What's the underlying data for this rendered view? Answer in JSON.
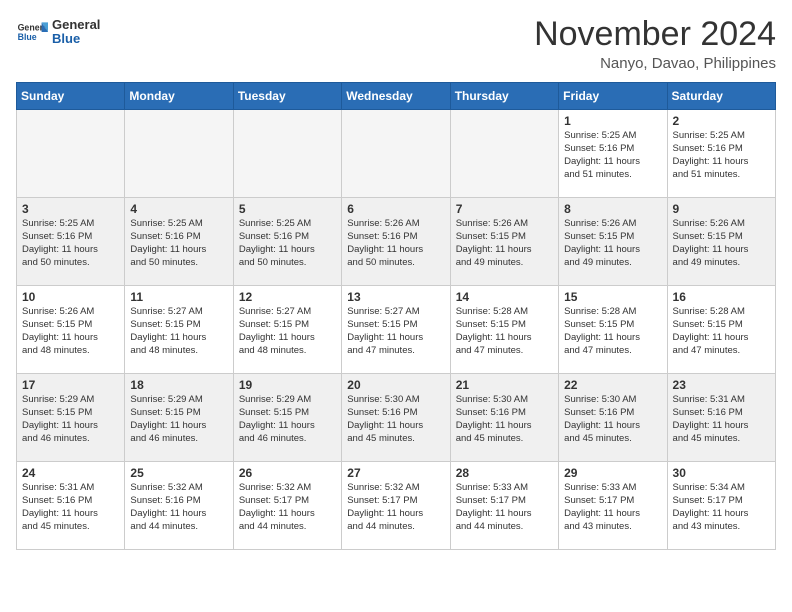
{
  "logo": {
    "general": "General",
    "blue": "Blue"
  },
  "title": "November 2024",
  "location": "Nanyo, Davao, Philippines",
  "header": {
    "days": [
      "Sunday",
      "Monday",
      "Tuesday",
      "Wednesday",
      "Thursday",
      "Friday",
      "Saturday"
    ]
  },
  "weeks": [
    [
      {
        "day": "",
        "content": ""
      },
      {
        "day": "",
        "content": ""
      },
      {
        "day": "",
        "content": ""
      },
      {
        "day": "",
        "content": ""
      },
      {
        "day": "",
        "content": ""
      },
      {
        "day": "1",
        "content": "Sunrise: 5:25 AM\nSunset: 5:16 PM\nDaylight: 11 hours\nand 51 minutes."
      },
      {
        "day": "2",
        "content": "Sunrise: 5:25 AM\nSunset: 5:16 PM\nDaylight: 11 hours\nand 51 minutes."
      }
    ],
    [
      {
        "day": "3",
        "content": "Sunrise: 5:25 AM\nSunset: 5:16 PM\nDaylight: 11 hours\nand 50 minutes."
      },
      {
        "day": "4",
        "content": "Sunrise: 5:25 AM\nSunset: 5:16 PM\nDaylight: 11 hours\nand 50 minutes."
      },
      {
        "day": "5",
        "content": "Sunrise: 5:25 AM\nSunset: 5:16 PM\nDaylight: 11 hours\nand 50 minutes."
      },
      {
        "day": "6",
        "content": "Sunrise: 5:26 AM\nSunset: 5:16 PM\nDaylight: 11 hours\nand 50 minutes."
      },
      {
        "day": "7",
        "content": "Sunrise: 5:26 AM\nSunset: 5:15 PM\nDaylight: 11 hours\nand 49 minutes."
      },
      {
        "day": "8",
        "content": "Sunrise: 5:26 AM\nSunset: 5:15 PM\nDaylight: 11 hours\nand 49 minutes."
      },
      {
        "day": "9",
        "content": "Sunrise: 5:26 AM\nSunset: 5:15 PM\nDaylight: 11 hours\nand 49 minutes."
      }
    ],
    [
      {
        "day": "10",
        "content": "Sunrise: 5:26 AM\nSunset: 5:15 PM\nDaylight: 11 hours\nand 48 minutes."
      },
      {
        "day": "11",
        "content": "Sunrise: 5:27 AM\nSunset: 5:15 PM\nDaylight: 11 hours\nand 48 minutes."
      },
      {
        "day": "12",
        "content": "Sunrise: 5:27 AM\nSunset: 5:15 PM\nDaylight: 11 hours\nand 48 minutes."
      },
      {
        "day": "13",
        "content": "Sunrise: 5:27 AM\nSunset: 5:15 PM\nDaylight: 11 hours\nand 47 minutes."
      },
      {
        "day": "14",
        "content": "Sunrise: 5:28 AM\nSunset: 5:15 PM\nDaylight: 11 hours\nand 47 minutes."
      },
      {
        "day": "15",
        "content": "Sunrise: 5:28 AM\nSunset: 5:15 PM\nDaylight: 11 hours\nand 47 minutes."
      },
      {
        "day": "16",
        "content": "Sunrise: 5:28 AM\nSunset: 5:15 PM\nDaylight: 11 hours\nand 47 minutes."
      }
    ],
    [
      {
        "day": "17",
        "content": "Sunrise: 5:29 AM\nSunset: 5:15 PM\nDaylight: 11 hours\nand 46 minutes."
      },
      {
        "day": "18",
        "content": "Sunrise: 5:29 AM\nSunset: 5:15 PM\nDaylight: 11 hours\nand 46 minutes."
      },
      {
        "day": "19",
        "content": "Sunrise: 5:29 AM\nSunset: 5:15 PM\nDaylight: 11 hours\nand 46 minutes."
      },
      {
        "day": "20",
        "content": "Sunrise: 5:30 AM\nSunset: 5:16 PM\nDaylight: 11 hours\nand 45 minutes."
      },
      {
        "day": "21",
        "content": "Sunrise: 5:30 AM\nSunset: 5:16 PM\nDaylight: 11 hours\nand 45 minutes."
      },
      {
        "day": "22",
        "content": "Sunrise: 5:30 AM\nSunset: 5:16 PM\nDaylight: 11 hours\nand 45 minutes."
      },
      {
        "day": "23",
        "content": "Sunrise: 5:31 AM\nSunset: 5:16 PM\nDaylight: 11 hours\nand 45 minutes."
      }
    ],
    [
      {
        "day": "24",
        "content": "Sunrise: 5:31 AM\nSunset: 5:16 PM\nDaylight: 11 hours\nand 45 minutes."
      },
      {
        "day": "25",
        "content": "Sunrise: 5:32 AM\nSunset: 5:16 PM\nDaylight: 11 hours\nand 44 minutes."
      },
      {
        "day": "26",
        "content": "Sunrise: 5:32 AM\nSunset: 5:17 PM\nDaylight: 11 hours\nand 44 minutes."
      },
      {
        "day": "27",
        "content": "Sunrise: 5:32 AM\nSunset: 5:17 PM\nDaylight: 11 hours\nand 44 minutes."
      },
      {
        "day": "28",
        "content": "Sunrise: 5:33 AM\nSunset: 5:17 PM\nDaylight: 11 hours\nand 44 minutes."
      },
      {
        "day": "29",
        "content": "Sunrise: 5:33 AM\nSunset: 5:17 PM\nDaylight: 11 hours\nand 43 minutes."
      },
      {
        "day": "30",
        "content": "Sunrise: 5:34 AM\nSunset: 5:17 PM\nDaylight: 11 hours\nand 43 minutes."
      }
    ]
  ]
}
